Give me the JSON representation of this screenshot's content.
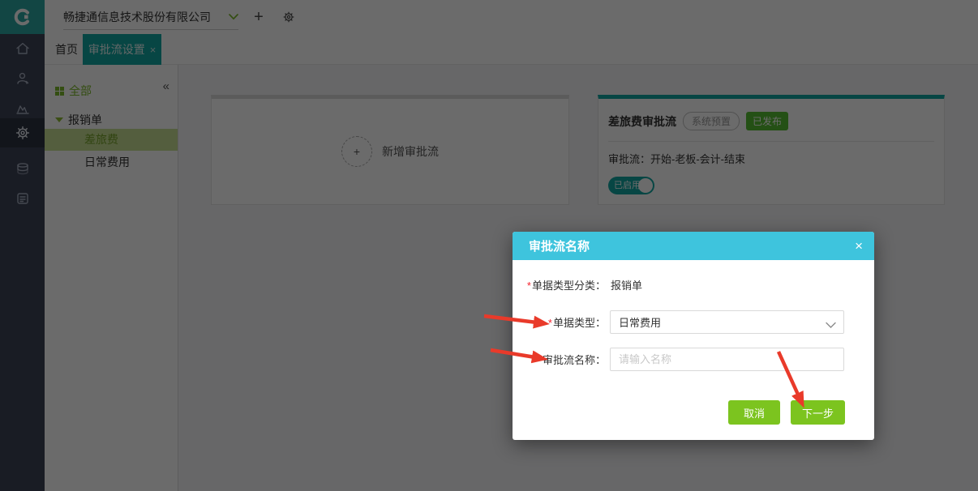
{
  "topbar": {
    "company_name": "畅捷通信息技术股份有限公司"
  },
  "tabs": [
    {
      "label": "首页"
    },
    {
      "label": "审批流设置"
    }
  ],
  "sidebar": {
    "icons": [
      "home",
      "user",
      "line-chart",
      "gear",
      "database",
      "document"
    ],
    "active_icon": "gear"
  },
  "tree": {
    "all_label": "全部",
    "group_label": "报销单",
    "items": [
      {
        "label": "差旅费",
        "selected": true
      },
      {
        "label": "日常费用",
        "selected": false
      }
    ]
  },
  "canvas": {
    "add_flow_label": "新增审批流",
    "flow_card": {
      "title": "差旅费审批流",
      "preset_badge": "系统预置",
      "status_badge": "已发布",
      "flow_desc": "审批流：开始-老板-会计-结束",
      "toggle_label": "已启用",
      "toggle_state": "on"
    }
  },
  "modal": {
    "title": "审批流名称",
    "required_mark": "*",
    "category_label": "单据类型分类：",
    "category_value": "报销单",
    "doc_type_label": "单据类型：",
    "doc_type_value": "日常费用",
    "name_label": "审批流名称：",
    "name_value": "",
    "name_placeholder": "请输入名称",
    "cancel_label": "取消",
    "next_label": "下一步"
  },
  "icons": {
    "close": "×",
    "collapse": "«",
    "plus": "+"
  },
  "colors": {
    "brand_teal": "#11A7A2",
    "modal_header_cyan": "#3EC4DD",
    "action_green": "#7CC41F",
    "published_green": "#57BE32",
    "tree_green": "#7CB92C",
    "arrow_red": "#E93A2A"
  }
}
